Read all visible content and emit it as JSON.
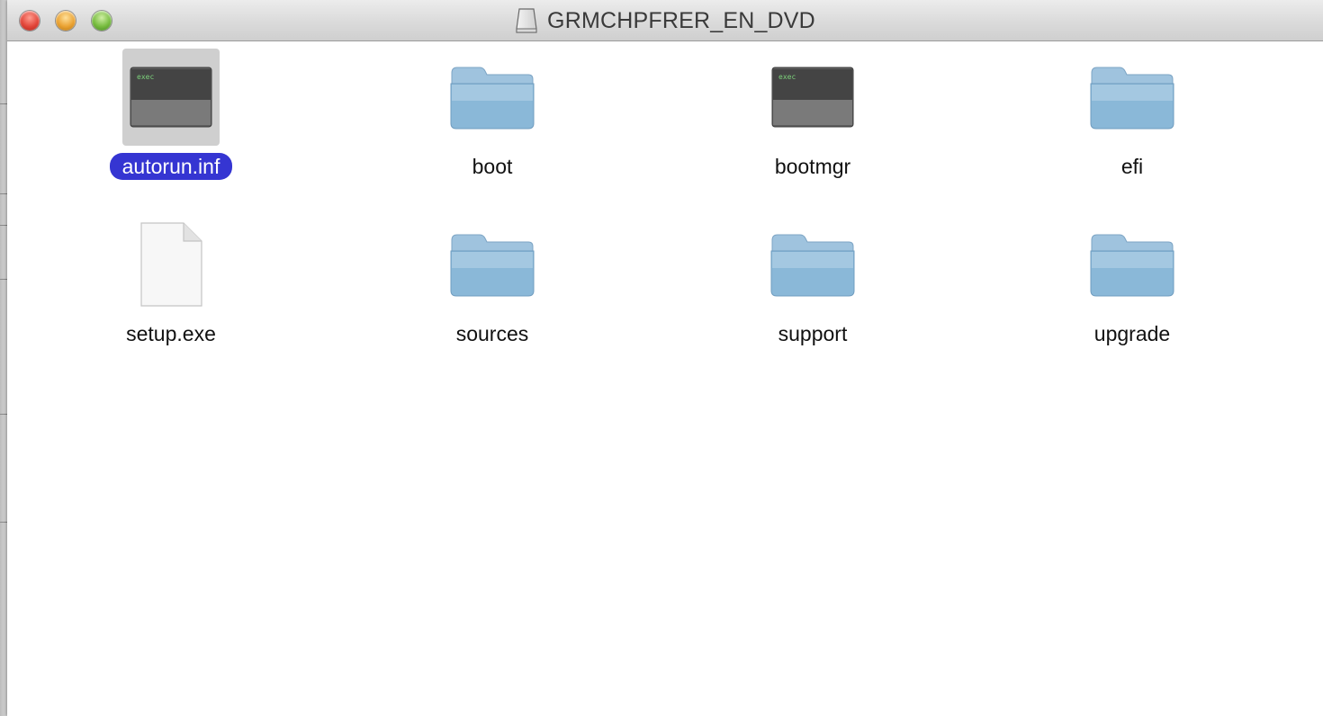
{
  "window": {
    "title": "GRMCHPFRER_EN_DVD",
    "title_icon": "disk-icon",
    "buttons": [
      "close-icon",
      "minimize-icon",
      "zoom-icon"
    ]
  },
  "colors": {
    "selection": "#3535d2",
    "selection_bg": "#cfcfcf",
    "folder": "#8ab8d8"
  },
  "items": [
    {
      "name": "autorun.inf",
      "icon": "exec-icon",
      "selected": true
    },
    {
      "name": "boot",
      "icon": "folder-icon",
      "selected": false
    },
    {
      "name": "bootmgr",
      "icon": "exec-icon",
      "selected": false
    },
    {
      "name": "efi",
      "icon": "folder-icon",
      "selected": false
    },
    {
      "name": "setup.exe",
      "icon": "document-icon",
      "selected": false
    },
    {
      "name": "sources",
      "icon": "folder-icon",
      "selected": false
    },
    {
      "name": "support",
      "icon": "folder-icon",
      "selected": false
    },
    {
      "name": "upgrade",
      "icon": "folder-icon",
      "selected": false
    }
  ],
  "exec_icon_text": "exec"
}
